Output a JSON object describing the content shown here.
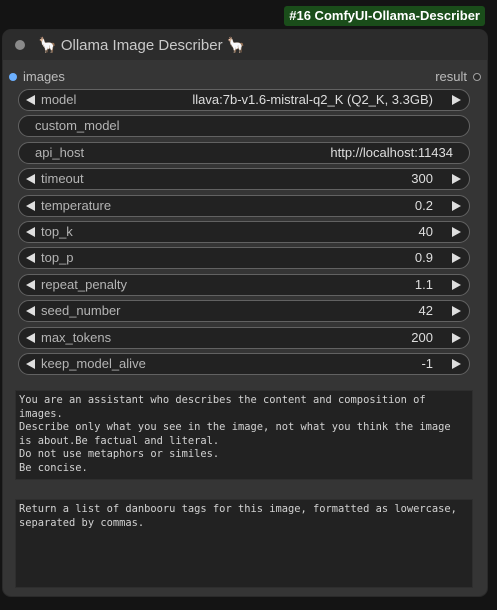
{
  "badge": "#16 ComfyUI-Ollama-Describer",
  "node": {
    "title": "🦙 Ollama Image Describer 🦙"
  },
  "io": {
    "input_label": "images",
    "output_label": "result"
  },
  "widgets": [
    {
      "label": "model",
      "value": "llava:7b-v1.6-mistral-q2_K (Q2_K, 3.3GB)"
    },
    {
      "label": "custom_model",
      "value": ""
    },
    {
      "label": "api_host",
      "value": "http://localhost:11434"
    },
    {
      "label": "timeout",
      "value": "300"
    },
    {
      "label": "temperature",
      "value": "0.2"
    },
    {
      "label": "top_k",
      "value": "40"
    },
    {
      "label": "top_p",
      "value": "0.9"
    },
    {
      "label": "repeat_penalty",
      "value": "1.1"
    },
    {
      "label": "seed_number",
      "value": "42"
    },
    {
      "label": "max_tokens",
      "value": "200"
    },
    {
      "label": "keep_model_alive",
      "value": "-1"
    }
  ],
  "system_prompt": "You are an assistant who describes the content and composition of images.\nDescribe only what you see in the image, not what you think the image is about.Be factual and literal.\nDo not use metaphors or similes.\nBe concise.",
  "prompt": "Return a list of danbooru tags for this image, formatted as lowercase, separated by commas."
}
